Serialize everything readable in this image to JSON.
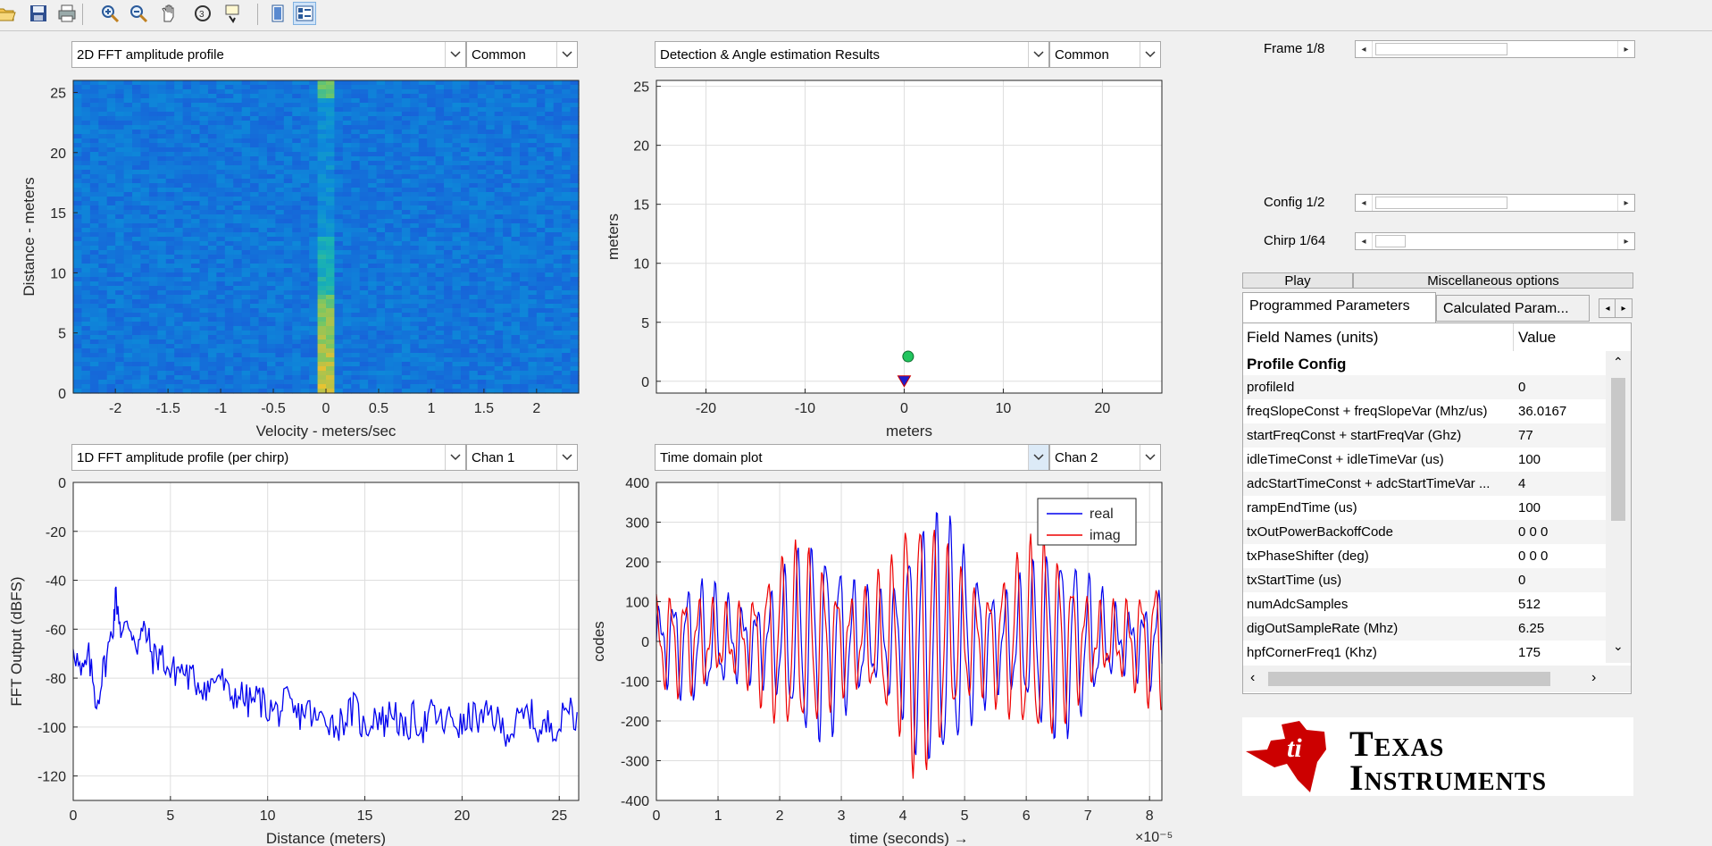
{
  "toolbar": {
    "icons": [
      "open-icon",
      "save-icon",
      "print-icon",
      "zoom-in-icon",
      "zoom-out-icon",
      "pan-icon",
      "rotate-3d-icon",
      "data-cursor-icon",
      "hide-plot-tools-icon",
      "show-plot-tools-icon"
    ]
  },
  "panels": {
    "range_doppler": {
      "dropdown": "2D FFT amplitude profile",
      "dropdown2": "Common"
    },
    "detection": {
      "dropdown": "Detection & Angle estimation Results",
      "dropdown2": "Common"
    },
    "range_profile": {
      "dropdown": "1D FFT amplitude profile (per chirp)",
      "dropdown2": "Chan 1"
    },
    "time_domain": {
      "dropdown": "Time domain plot",
      "dropdown2": "Chan 2"
    }
  },
  "chart_data": [
    {
      "id": "range_doppler",
      "type": "heatmap",
      "xlabel": "Velocity - meters/sec",
      "ylabel": "Distance - meters",
      "xlim": [
        -2.4,
        2.4
      ],
      "ylim": [
        0,
        26
      ],
      "xticks": [
        "-2",
        "-1.5",
        "-1",
        "-0.5",
        "0",
        "0.5",
        "1",
        "1.5",
        "2"
      ],
      "yticks": [
        "0",
        "5",
        "10",
        "15",
        "20",
        "25"
      ],
      "colormap": "parula"
    },
    {
      "id": "detection",
      "type": "scatter",
      "xlabel": "meters",
      "ylabel": "meters",
      "xlim": [
        -25,
        26
      ],
      "ylim": [
        -1,
        25.5
      ],
      "xticks": [
        "-20",
        "-10",
        "0",
        "10",
        "20"
      ],
      "yticks": [
        "0",
        "5",
        "10",
        "15",
        "20",
        "25"
      ],
      "grid": true,
      "points": [
        {
          "x": 0.4,
          "y": 2.1,
          "color": "#22c55e",
          "marker": "circle"
        }
      ],
      "radar_marker": {
        "x": 0,
        "y": 0,
        "color": "#1e1ecc",
        "marker": "triangle-down"
      }
    },
    {
      "id": "range_profile",
      "type": "line",
      "xlabel": "Distance (meters)",
      "ylabel": "FFT Output (dBFS)",
      "xlim": [
        0,
        26
      ],
      "ylim": [
        -130,
        0
      ],
      "xticks": [
        "0",
        "5",
        "10",
        "15",
        "20",
        "25"
      ],
      "yticks": [
        "0",
        "-20",
        "-40",
        "-60",
        "-80",
        "-100",
        "-120"
      ],
      "grid": true,
      "series": [
        {
          "color": "#0000ee",
          "x": [
            0,
            0.4,
            0.8,
            1.2,
            1.6,
            2.0,
            2.2,
            2.5,
            2.9,
            3.3,
            3.7,
            4.1,
            4.5,
            5,
            5.5,
            6,
            6.5,
            7,
            7.5,
            8,
            8.5,
            9,
            9.5,
            10,
            10.5,
            11,
            11.5,
            12,
            12.5,
            13,
            13.5,
            14,
            14.5,
            15,
            15.5,
            16,
            16.5,
            17,
            17.5,
            18,
            18.5,
            19,
            19.5,
            20,
            20.5,
            21,
            21.5,
            22,
            22.5,
            23,
            23.5,
            24,
            24.5,
            25,
            25.5,
            26
          ],
          "values": [
            -65,
            -80,
            -72,
            -90,
            -75,
            -62,
            -46,
            -62,
            -58,
            -66,
            -60,
            -72,
            -70,
            -78,
            -76,
            -80,
            -82,
            -84,
            -78,
            -88,
            -86,
            -90,
            -88,
            -92,
            -94,
            -90,
            -96,
            -92,
            -98,
            -95,
            -100,
            -96,
            -92,
            -102,
            -94,
            -98,
            -92,
            -104,
            -96,
            -100,
            -94,
            -99,
            -96,
            -101,
            -95,
            -98,
            -94,
            -100,
            -102,
            -97,
            -94,
            -103,
            -98,
            -100,
            -90,
            -98
          ]
        }
      ]
    },
    {
      "id": "time_domain",
      "type": "line",
      "xlabel": "time  (seconds) →",
      "ylabel": "codes",
      "x_multiplier": "×10⁻⁵",
      "xlim": [
        0,
        8.2
      ],
      "ylim": [
        -400,
        400
      ],
      "xticks": [
        "0",
        "1",
        "2",
        "3",
        "4",
        "5",
        "6",
        "7",
        "8"
      ],
      "yticks": [
        "400",
        "300",
        "200",
        "100",
        "0",
        "-100",
        "-200",
        "-300",
        "-400"
      ],
      "grid": true,
      "series": [
        {
          "name": "real",
          "color": "#0000ee"
        },
        {
          "name": "imag",
          "color": "#ee0000"
        }
      ]
    }
  ],
  "controls": {
    "frame_label": "Frame 1/8",
    "frame_value": 0,
    "config_label": "Config 1/2",
    "config_value": 0,
    "chirp_label": "Chirp 1/64",
    "chirp_value": 0,
    "play_label": "Play",
    "misc_label": "Miscellaneous options"
  },
  "tabs": {
    "active": "Programmed Parameters",
    "inactive": "Calculated Param..."
  },
  "table": {
    "header_field": "Field Names    (units)",
    "header_value": "Value",
    "rows": [
      {
        "name": "Profile Config",
        "value": "",
        "bold": true
      },
      {
        "name": "profileId",
        "value": "0"
      },
      {
        "name": "freqSlopeConst + freqSlopeVar (Mhz/us)",
        "value": "36.0167"
      },
      {
        "name": "startFreqConst + startFreqVar (Ghz)",
        "value": "77"
      },
      {
        "name": "idleTimeConst + idleTimeVar (us)",
        "value": "100"
      },
      {
        "name": "adcStartTimeConst + adcStartTimeVar ...",
        "value": "4"
      },
      {
        "name": "rampEndTime (us)",
        "value": "100"
      },
      {
        "name": "txOutPowerBackoffCode",
        "value": "0 0 0"
      },
      {
        "name": "txPhaseShifter (deg)",
        "value": "0 0 0"
      },
      {
        "name": "txStartTime (us)",
        "value": "0"
      },
      {
        "name": "numAdcSamples",
        "value": "512"
      },
      {
        "name": "digOutSampleRate (Mhz)",
        "value": "6.25"
      },
      {
        "name": "hpfCornerFreq1 (Khz)",
        "value": "175"
      }
    ]
  },
  "logo": {
    "line1": "Texas",
    "line2": "Instruments",
    "color": "#cc0000"
  }
}
